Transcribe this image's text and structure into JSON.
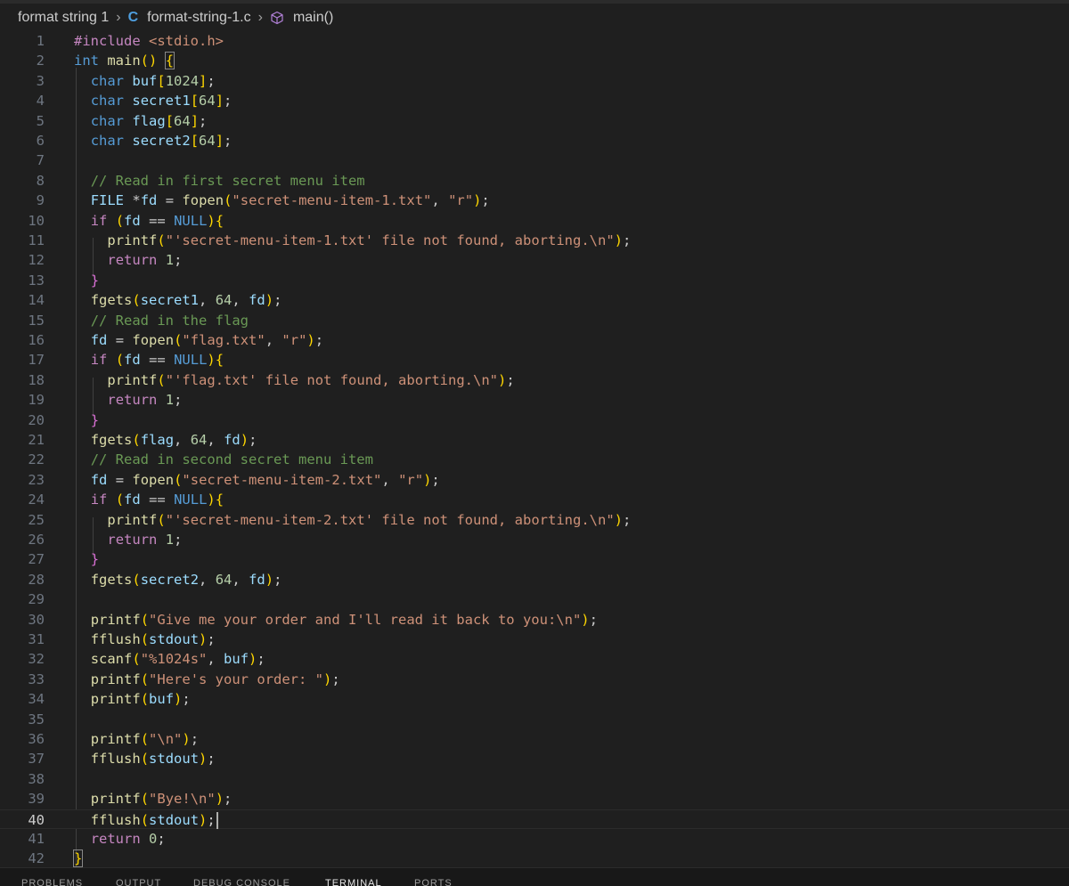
{
  "breadcrumb": {
    "folder": "format string 1",
    "file": "format-string-1.c",
    "file_icon": "C",
    "symbol": "main()"
  },
  "editor": {
    "active_line": 40,
    "lines": [
      "#include <stdio.h>",
      "int main() {",
      "char buf[1024];",
      "char secret1[64];",
      "char flag[64];",
      "char secret2[64];",
      "",
      "// Read in first secret menu item",
      "FILE *fd = fopen(\"secret-menu-item-1.txt\", \"r\");",
      "if (fd == NULL){",
      "printf(\"'secret-menu-item-1.txt' file not found, aborting.\\n\");",
      "return 1;",
      "}",
      "fgets(secret1, 64, fd);",
      "// Read in the flag",
      "fd = fopen(\"flag.txt\", \"r\");",
      "if (fd == NULL){",
      "printf(\"'flag.txt' file not found, aborting.\\n\");",
      "return 1;",
      "}",
      "fgets(flag, 64, fd);",
      "// Read in second secret menu item",
      "fd = fopen(\"secret-menu-item-2.txt\", \"r\");",
      "if (fd == NULL){",
      "printf(\"'secret-menu-item-2.txt' file not found, aborting.\\n\");",
      "return 1;",
      "}",
      "fgets(secret2, 64, fd);",
      "",
      "printf(\"Give me your order and I'll read it back to you:\\n\");",
      "fflush(stdout);",
      "scanf(\"%1024s\", buf);",
      "printf(\"Here's your order: \");",
      "printf(buf);",
      "",
      "printf(\"\\n\");",
      "fflush(stdout);",
      "",
      "printf(\"Bye!\\n\");",
      "fflush(stdout);",
      "return 0;",
      "}"
    ]
  },
  "panel": {
    "tabs": [
      "PROBLEMS",
      "OUTPUT",
      "DEBUG CONSOLE",
      "TERMINAL",
      "PORTS"
    ],
    "active_tab": "TERMINAL"
  }
}
